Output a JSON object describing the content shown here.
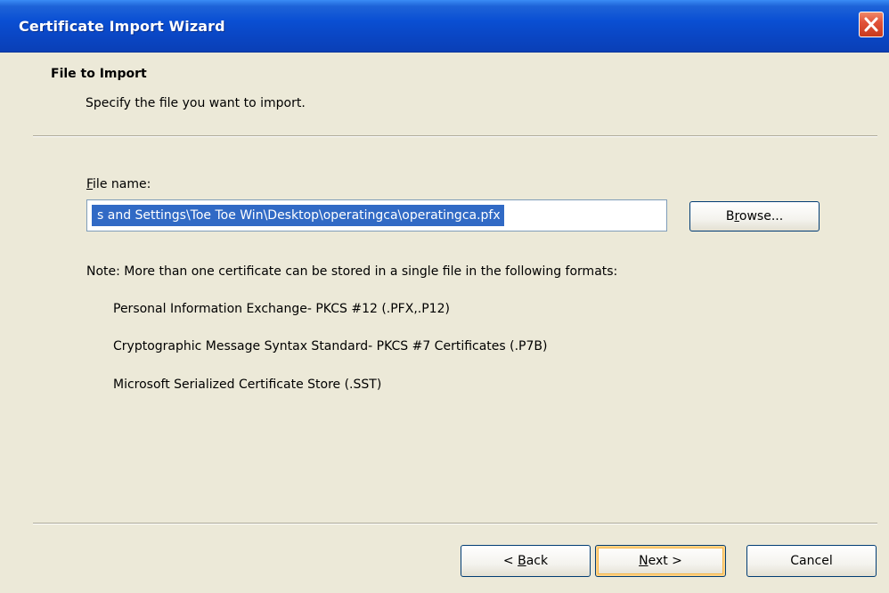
{
  "window": {
    "title": "Certificate Import Wizard"
  },
  "header": {
    "title": "File to Import",
    "subtitle": "Specify the file you want to import."
  },
  "file_field": {
    "label_accel": "F",
    "label_rest": "ile name:",
    "value": "s and Settings\\Toe Toe Win\\Desktop\\operatingca\\operatingca.pfx",
    "browse_accel": "r",
    "browse_pre": "B",
    "browse_post": "owse..."
  },
  "note": {
    "text": "Note:  More than one certificate can be stored in a single file in the following formats:",
    "formats": [
      "Personal Information Exchange- PKCS #12 (.PFX,.P12)",
      "Cryptographic Message Syntax Standard- PKCS #7 Certificates (.P7B)",
      "Microsoft Serialized Certificate Store (.SST)"
    ]
  },
  "footer": {
    "back_pre": "< ",
    "back_accel": "B",
    "back_post": "ack",
    "next_accel": "N",
    "next_post": "ext >",
    "cancel": "Cancel"
  },
  "colors": {
    "titlebar": "#0a46c4",
    "window_bg": "#ece9d8",
    "selection": "#316ac5",
    "close_button": "#e2533a"
  },
  "icons": {
    "close": "close-icon"
  }
}
